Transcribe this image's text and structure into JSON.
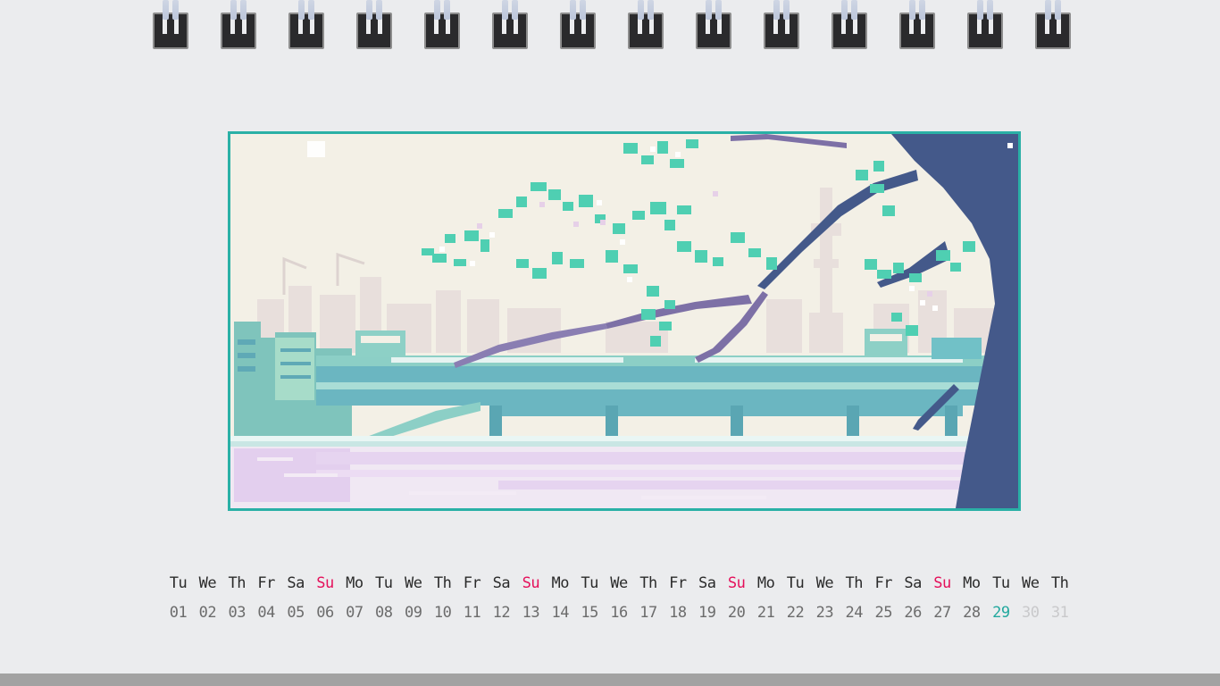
{
  "binding": {
    "ring_count": 14,
    "ring_icon": "binder-ring-icon"
  },
  "artwork": {
    "subject": "pixel-art-city-river-cherry-branch",
    "colors": {
      "frame": "#2ab0a6",
      "sky": "#f3f0e6",
      "leaves": "#4fcfb2",
      "trunk": "#44598a",
      "water": "#e5d3ef"
    }
  },
  "calendar": {
    "weekdays": [
      "Tu",
      "We",
      "Th",
      "Fr",
      "Sa",
      "Su",
      "Mo",
      "Tu",
      "We",
      "Th",
      "Fr",
      "Sa",
      "Su",
      "Mo",
      "Tu",
      "We",
      "Th",
      "Fr",
      "Sa",
      "Su",
      "Mo",
      "Tu",
      "We",
      "Th",
      "Fr",
      "Sa",
      "Su",
      "Mo",
      "Tu",
      "We",
      "Th"
    ],
    "days": [
      "01",
      "02",
      "03",
      "04",
      "05",
      "06",
      "07",
      "08",
      "09",
      "10",
      "11",
      "12",
      "13",
      "14",
      "15",
      "16",
      "17",
      "18",
      "19",
      "20",
      "21",
      "22",
      "23",
      "24",
      "25",
      "26",
      "27",
      "28",
      "29",
      "30",
      "31"
    ],
    "today": "29",
    "colors": {
      "sunday": "#e5105b",
      "today": "#22a89e",
      "past": "#6c6c6c",
      "future": "#c9c9cb"
    }
  }
}
